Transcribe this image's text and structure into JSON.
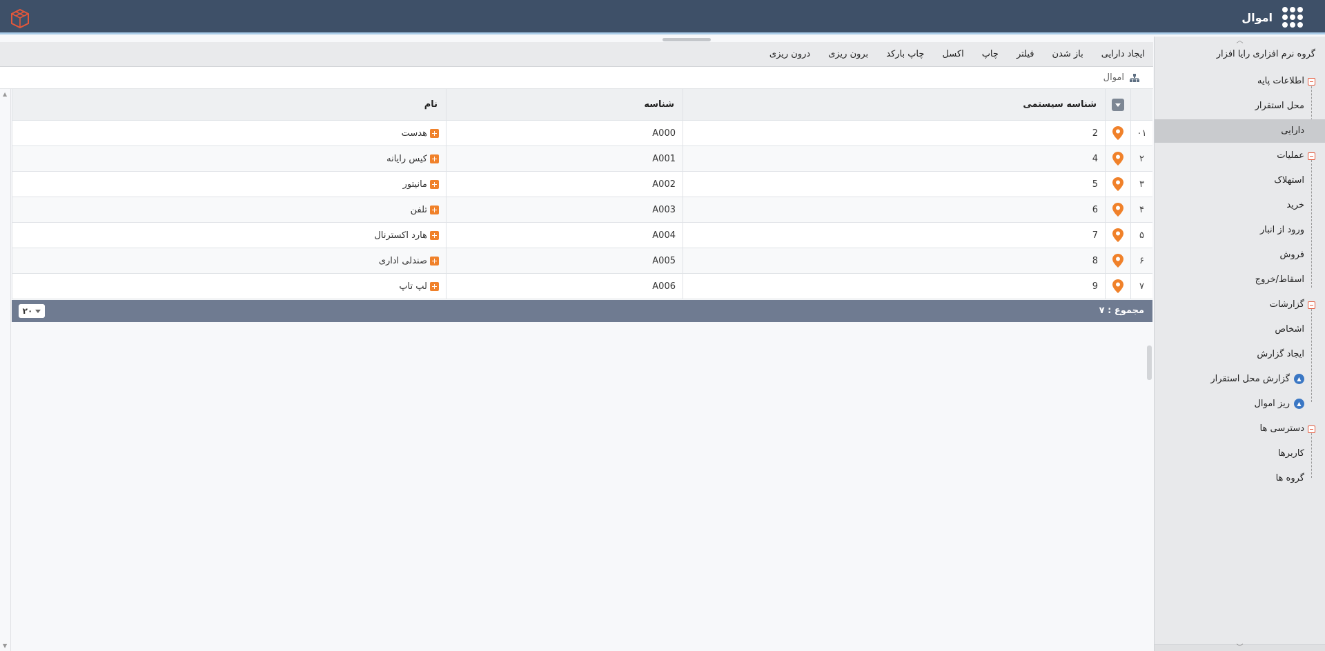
{
  "app": {
    "title": "اموال"
  },
  "sidebar": {
    "root": "گروه نرم افزاری رایا افزار",
    "groups": [
      {
        "label": "اطلاعات پایه",
        "items": [
          "محل استقرار",
          "دارایی"
        ]
      },
      {
        "label": "عملیات",
        "items": [
          "استهلاک",
          "خرید",
          "ورود از انبار",
          "فروش",
          "اسقاط/خروج"
        ]
      },
      {
        "label": "گزارشات",
        "items": [
          "اشخاص",
          "ایجاد گزارش",
          "گزارش محل استقرار",
          "ریز اموال"
        ]
      },
      {
        "label": "دسترسی ها",
        "items": [
          "کاربرها",
          "گروه ها"
        ]
      }
    ],
    "active_item": "دارایی"
  },
  "toolbar": {
    "buttons": [
      "ایجاد دارایی",
      "باز شدن",
      "فیلتر",
      "چاپ",
      "اکسل",
      "چاپ بارکد",
      "برون ریزی",
      "درون ریزی"
    ]
  },
  "breadcrumb": {
    "label": "اموال"
  },
  "grid": {
    "columns": {
      "system_id": "شناسه سیستمی",
      "id": "شناسه",
      "name": "نام"
    },
    "rows": [
      {
        "index": "۰۱",
        "system_id": "2",
        "id": "A000",
        "name": "هدست"
      },
      {
        "index": "۲",
        "system_id": "4",
        "id": "A001",
        "name": "کیس رایانه"
      },
      {
        "index": "۳",
        "system_id": "5",
        "id": "A002",
        "name": "مانیتور"
      },
      {
        "index": "۴",
        "system_id": "6",
        "id": "A003",
        "name": "تلفن"
      },
      {
        "index": "۵",
        "system_id": "7",
        "id": "A004",
        "name": "هارد اکسترنال"
      },
      {
        "index": "۶",
        "system_id": "8",
        "id": "A005",
        "name": "صندلی اداری"
      },
      {
        "index": "۷",
        "system_id": "9",
        "id": "A006",
        "name": "لپ تاپ"
      }
    ],
    "footer": {
      "total": "مجموع :  ۷",
      "page_size": "۲۰"
    }
  },
  "colors": {
    "topbar": "#3e5068",
    "accent": "#f0812a",
    "footer": "#6f7b91"
  }
}
